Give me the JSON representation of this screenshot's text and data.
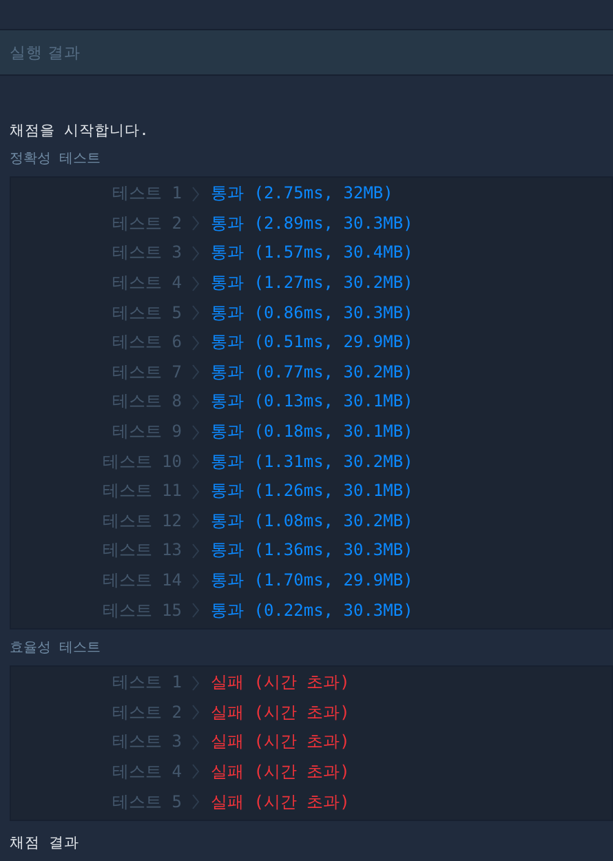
{
  "panel": {
    "title": "실행 결과"
  },
  "console": {
    "intro": "채점을 시작합니다.",
    "sections": [
      {
        "title": "정확성  테스트",
        "rows": [
          {
            "label": "테스트 1",
            "result": "통과 (2.75ms, 32MB)",
            "kind": "pass"
          },
          {
            "label": "테스트 2",
            "result": "통과 (2.89ms, 30.3MB)",
            "kind": "pass"
          },
          {
            "label": "테스트 3",
            "result": "통과 (1.57ms, 30.4MB)",
            "kind": "pass"
          },
          {
            "label": "테스트 4",
            "result": "통과 (1.27ms, 30.2MB)",
            "kind": "pass"
          },
          {
            "label": "테스트 5",
            "result": "통과 (0.86ms, 30.3MB)",
            "kind": "pass"
          },
          {
            "label": "테스트 6",
            "result": "통과 (0.51ms, 29.9MB)",
            "kind": "pass"
          },
          {
            "label": "테스트 7",
            "result": "통과 (0.77ms, 30.2MB)",
            "kind": "pass"
          },
          {
            "label": "테스트 8",
            "result": "통과 (0.13ms, 30.1MB)",
            "kind": "pass"
          },
          {
            "label": "테스트 9",
            "result": "통과 (0.18ms, 30.1MB)",
            "kind": "pass"
          },
          {
            "label": "테스트 10",
            "result": "통과 (1.31ms, 30.2MB)",
            "kind": "pass"
          },
          {
            "label": "테스트 11",
            "result": "통과 (1.26ms, 30.1MB)",
            "kind": "pass"
          },
          {
            "label": "테스트 12",
            "result": "통과 (1.08ms, 30.2MB)",
            "kind": "pass"
          },
          {
            "label": "테스트 13",
            "result": "통과 (1.36ms, 30.3MB)",
            "kind": "pass"
          },
          {
            "label": "테스트 14",
            "result": "통과 (1.70ms, 29.9MB)",
            "kind": "pass"
          },
          {
            "label": "테스트 15",
            "result": "통과 (0.22ms, 30.3MB)",
            "kind": "pass"
          }
        ]
      },
      {
        "title": "효율성  테스트",
        "rows": [
          {
            "label": "테스트 1",
            "result": "실패 (시간 초과)",
            "kind": "fail"
          },
          {
            "label": "테스트 2",
            "result": "실패 (시간 초과)",
            "kind": "fail"
          },
          {
            "label": "테스트 3",
            "result": "실패 (시간 초과)",
            "kind": "fail"
          },
          {
            "label": "테스트 4",
            "result": "실패 (시간 초과)",
            "kind": "fail"
          },
          {
            "label": "테스트 5",
            "result": "실패 (시간 초과)",
            "kind": "fail"
          }
        ]
      }
    ],
    "summary": "채점 결과"
  }
}
